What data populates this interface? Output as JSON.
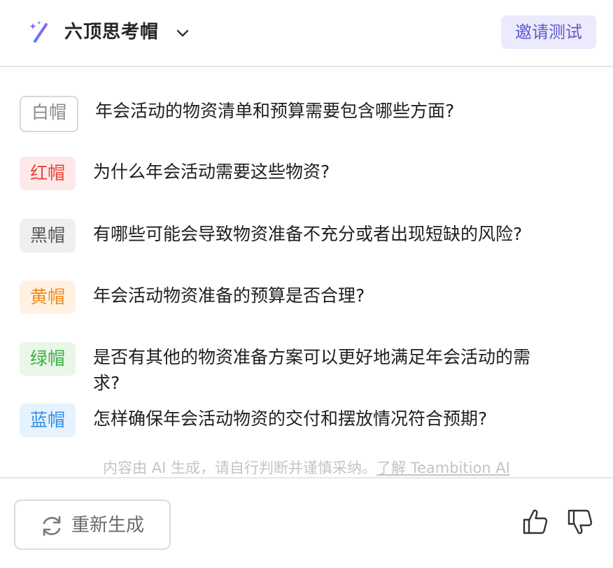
{
  "header": {
    "title": "六顶思考帽",
    "invite_label": "邀请测试"
  },
  "hats": [
    {
      "label": "白帽",
      "question": "年会活动的物资清单和预算需要包含哪些方面?"
    },
    {
      "label": "红帽",
      "question": "为什么年会活动需要这些物资?"
    },
    {
      "label": "黑帽",
      "question": "有哪些可能会导致物资准备不充分或者出现短缺的风险?"
    },
    {
      "label": "黄帽",
      "question": "年会活动物资准备的预算是否合理?"
    },
    {
      "label": "绿帽",
      "question": "是否有其他的物资准备方案可以更好地满足年会活动的需求?"
    },
    {
      "label": "蓝帽",
      "question": "怎样确保年会活动物资的交付和摆放情况符合预期?"
    }
  ],
  "disclaimer": {
    "text": "内容由 AI 生成，请自行判断并谨慎采纳。",
    "link": "了解 Teambition AI"
  },
  "footer": {
    "regenerate_label": "重新生成"
  },
  "icons": [
    "magic-wand-icon",
    "chevron-down-icon",
    "refresh-icon",
    "thumbs-up-icon",
    "thumbs-down-icon"
  ],
  "colors": {
    "accent": "#5e5acb",
    "white_hat": "#8a8a8a",
    "red_hat": "#e5443b",
    "black_hat": "#555555",
    "yellow_hat": "#f08a1c",
    "green_hat": "#3fae45",
    "blue_hat": "#2f8fe6"
  }
}
